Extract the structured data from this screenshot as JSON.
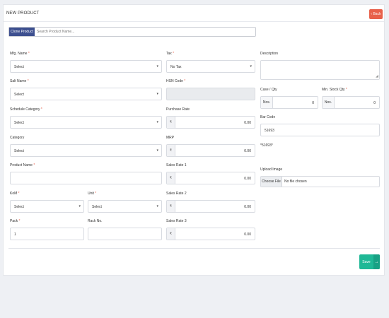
{
  "header": {
    "title": "NEW PRODUCT",
    "back_label": "‹ Back"
  },
  "clone": {
    "button_label": "Clone Product",
    "placeholder": "Search Product Name..."
  },
  "form": {
    "mfg": {
      "label": "Mfg. Name",
      "value": "Select"
    },
    "salt": {
      "label": "Salt Name",
      "value": "Select"
    },
    "schedule": {
      "label": "Schedule Category",
      "value": "Select"
    },
    "category": {
      "label": "Category",
      "value": "Select"
    },
    "product_name": {
      "label": "Product Name",
      "value": ""
    },
    "kom": {
      "label": "KoM",
      "value": "Select"
    },
    "unit": {
      "label": "Unit",
      "value": "Select"
    },
    "pack": {
      "label": "Pack",
      "value": "1"
    },
    "rack": {
      "label": "Rack No.",
      "value": ""
    },
    "tax": {
      "label": "Tax",
      "value": "No Tax"
    },
    "hsn": {
      "label": "HSN Code"
    },
    "purchase_rate": {
      "label": "Purchase Rate",
      "value": "0.00"
    },
    "mrp": {
      "label": "MRP",
      "value": "0.00"
    },
    "sales_rate_1": {
      "label": "Sales Rate 1",
      "value": "0.00"
    },
    "sales_rate_2": {
      "label": "Sales Rate 2",
      "value": "0.00"
    },
    "sales_rate_3": {
      "label": "Sales Rate 3",
      "value": "0.00"
    },
    "description": {
      "label": "Description"
    },
    "case_qty": {
      "label": "Case / Qty",
      "unit": "Nos.",
      "value": "0"
    },
    "min_stock": {
      "label": "Min. Stock Qty",
      "unit": "Nos.",
      "value": "0"
    },
    "barcode": {
      "label": "Bar Code",
      "value": "51693",
      "display": "*51693*"
    },
    "upload": {
      "label": "Upload Image",
      "button": "Choose File",
      "status": "No file chosen"
    }
  },
  "currency_symbol": "₹",
  "required_mark": "*",
  "actions": {
    "save_label": "Save",
    "save_arrow": "→"
  }
}
